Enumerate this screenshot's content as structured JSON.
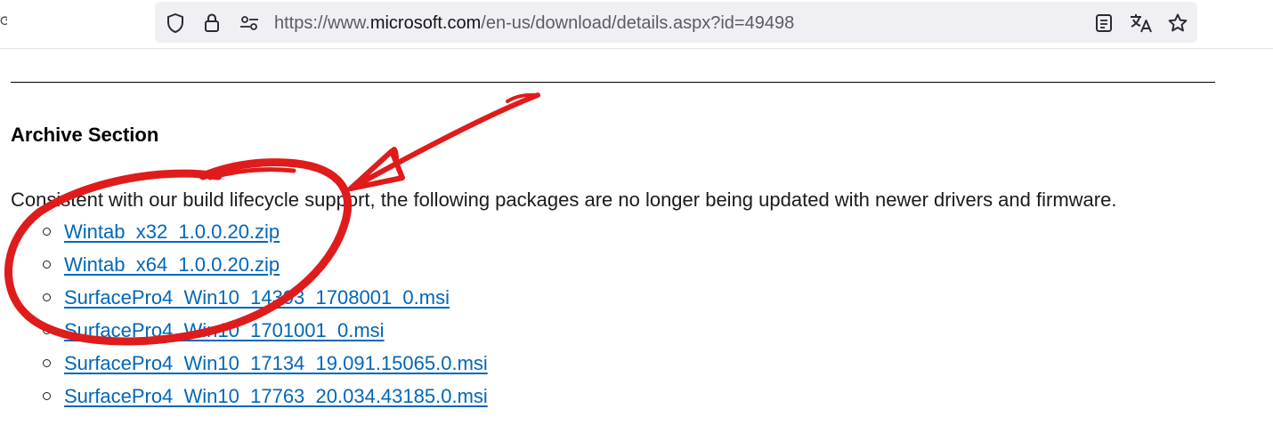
{
  "browser": {
    "url_prefix": "https://www.",
    "url_domain": "microsoft.com",
    "url_path": "/en-us/download/details.aspx?id=49498",
    "icons": {
      "shield": "shield-icon",
      "lock": "lock-icon",
      "permissions": "permissions-icon",
      "reader": "reader-view-icon",
      "translate": "translate-icon",
      "bookmark": "bookmark-star-icon"
    }
  },
  "page": {
    "heading": "Archive Section",
    "lead": "Consistent with our build lifecycle support, the following packages are no longer being updated with newer drivers and firmware.",
    "files": [
      "Wintab_x32_1.0.0.20.zip",
      "Wintab_x64_1.0.0.20.zip",
      "SurfacePro4_Win10_14393_1708001_0.msi",
      "SurfacePro4_Win10_1701001_0.msi",
      "SurfacePro4_Win10_17134_19.091.15065.0.msi",
      "SurfacePro4_Win10_17763_20.034.43185.0.msi"
    ],
    "link_color": "#0067b8",
    "annotation_color": "#e01b1b"
  }
}
